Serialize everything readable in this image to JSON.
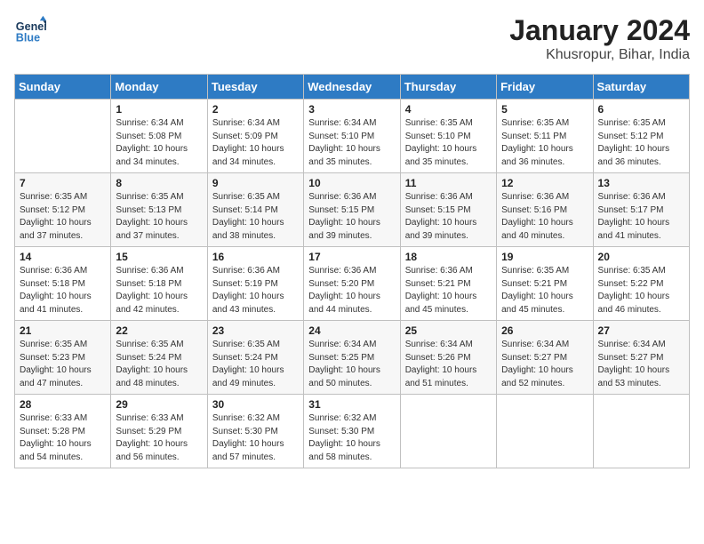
{
  "header": {
    "logo_line1": "General",
    "logo_line2": "Blue",
    "title": "January 2024",
    "subtitle": "Khusropur, Bihar, India"
  },
  "weekdays": [
    "Sunday",
    "Monday",
    "Tuesday",
    "Wednesday",
    "Thursday",
    "Friday",
    "Saturday"
  ],
  "weeks": [
    [
      {
        "day": "",
        "info": ""
      },
      {
        "day": "1",
        "info": "Sunrise: 6:34 AM\nSunset: 5:08 PM\nDaylight: 10 hours\nand 34 minutes."
      },
      {
        "day": "2",
        "info": "Sunrise: 6:34 AM\nSunset: 5:09 PM\nDaylight: 10 hours\nand 34 minutes."
      },
      {
        "day": "3",
        "info": "Sunrise: 6:34 AM\nSunset: 5:10 PM\nDaylight: 10 hours\nand 35 minutes."
      },
      {
        "day": "4",
        "info": "Sunrise: 6:35 AM\nSunset: 5:10 PM\nDaylight: 10 hours\nand 35 minutes."
      },
      {
        "day": "5",
        "info": "Sunrise: 6:35 AM\nSunset: 5:11 PM\nDaylight: 10 hours\nand 36 minutes."
      },
      {
        "day": "6",
        "info": "Sunrise: 6:35 AM\nSunset: 5:12 PM\nDaylight: 10 hours\nand 36 minutes."
      }
    ],
    [
      {
        "day": "7",
        "info": "Sunrise: 6:35 AM\nSunset: 5:12 PM\nDaylight: 10 hours\nand 37 minutes."
      },
      {
        "day": "8",
        "info": "Sunrise: 6:35 AM\nSunset: 5:13 PM\nDaylight: 10 hours\nand 37 minutes."
      },
      {
        "day": "9",
        "info": "Sunrise: 6:35 AM\nSunset: 5:14 PM\nDaylight: 10 hours\nand 38 minutes."
      },
      {
        "day": "10",
        "info": "Sunrise: 6:36 AM\nSunset: 5:15 PM\nDaylight: 10 hours\nand 39 minutes."
      },
      {
        "day": "11",
        "info": "Sunrise: 6:36 AM\nSunset: 5:15 PM\nDaylight: 10 hours\nand 39 minutes."
      },
      {
        "day": "12",
        "info": "Sunrise: 6:36 AM\nSunset: 5:16 PM\nDaylight: 10 hours\nand 40 minutes."
      },
      {
        "day": "13",
        "info": "Sunrise: 6:36 AM\nSunset: 5:17 PM\nDaylight: 10 hours\nand 41 minutes."
      }
    ],
    [
      {
        "day": "14",
        "info": "Sunrise: 6:36 AM\nSunset: 5:18 PM\nDaylight: 10 hours\nand 41 minutes."
      },
      {
        "day": "15",
        "info": "Sunrise: 6:36 AM\nSunset: 5:18 PM\nDaylight: 10 hours\nand 42 minutes."
      },
      {
        "day": "16",
        "info": "Sunrise: 6:36 AM\nSunset: 5:19 PM\nDaylight: 10 hours\nand 43 minutes."
      },
      {
        "day": "17",
        "info": "Sunrise: 6:36 AM\nSunset: 5:20 PM\nDaylight: 10 hours\nand 44 minutes."
      },
      {
        "day": "18",
        "info": "Sunrise: 6:36 AM\nSunset: 5:21 PM\nDaylight: 10 hours\nand 45 minutes."
      },
      {
        "day": "19",
        "info": "Sunrise: 6:35 AM\nSunset: 5:21 PM\nDaylight: 10 hours\nand 45 minutes."
      },
      {
        "day": "20",
        "info": "Sunrise: 6:35 AM\nSunset: 5:22 PM\nDaylight: 10 hours\nand 46 minutes."
      }
    ],
    [
      {
        "day": "21",
        "info": "Sunrise: 6:35 AM\nSunset: 5:23 PM\nDaylight: 10 hours\nand 47 minutes."
      },
      {
        "day": "22",
        "info": "Sunrise: 6:35 AM\nSunset: 5:24 PM\nDaylight: 10 hours\nand 48 minutes."
      },
      {
        "day": "23",
        "info": "Sunrise: 6:35 AM\nSunset: 5:24 PM\nDaylight: 10 hours\nand 49 minutes."
      },
      {
        "day": "24",
        "info": "Sunrise: 6:34 AM\nSunset: 5:25 PM\nDaylight: 10 hours\nand 50 minutes."
      },
      {
        "day": "25",
        "info": "Sunrise: 6:34 AM\nSunset: 5:26 PM\nDaylight: 10 hours\nand 51 minutes."
      },
      {
        "day": "26",
        "info": "Sunrise: 6:34 AM\nSunset: 5:27 PM\nDaylight: 10 hours\nand 52 minutes."
      },
      {
        "day": "27",
        "info": "Sunrise: 6:34 AM\nSunset: 5:27 PM\nDaylight: 10 hours\nand 53 minutes."
      }
    ],
    [
      {
        "day": "28",
        "info": "Sunrise: 6:33 AM\nSunset: 5:28 PM\nDaylight: 10 hours\nand 54 minutes."
      },
      {
        "day": "29",
        "info": "Sunrise: 6:33 AM\nSunset: 5:29 PM\nDaylight: 10 hours\nand 56 minutes."
      },
      {
        "day": "30",
        "info": "Sunrise: 6:32 AM\nSunset: 5:30 PM\nDaylight: 10 hours\nand 57 minutes."
      },
      {
        "day": "31",
        "info": "Sunrise: 6:32 AM\nSunset: 5:30 PM\nDaylight: 10 hours\nand 58 minutes."
      },
      {
        "day": "",
        "info": ""
      },
      {
        "day": "",
        "info": ""
      },
      {
        "day": "",
        "info": ""
      }
    ]
  ]
}
